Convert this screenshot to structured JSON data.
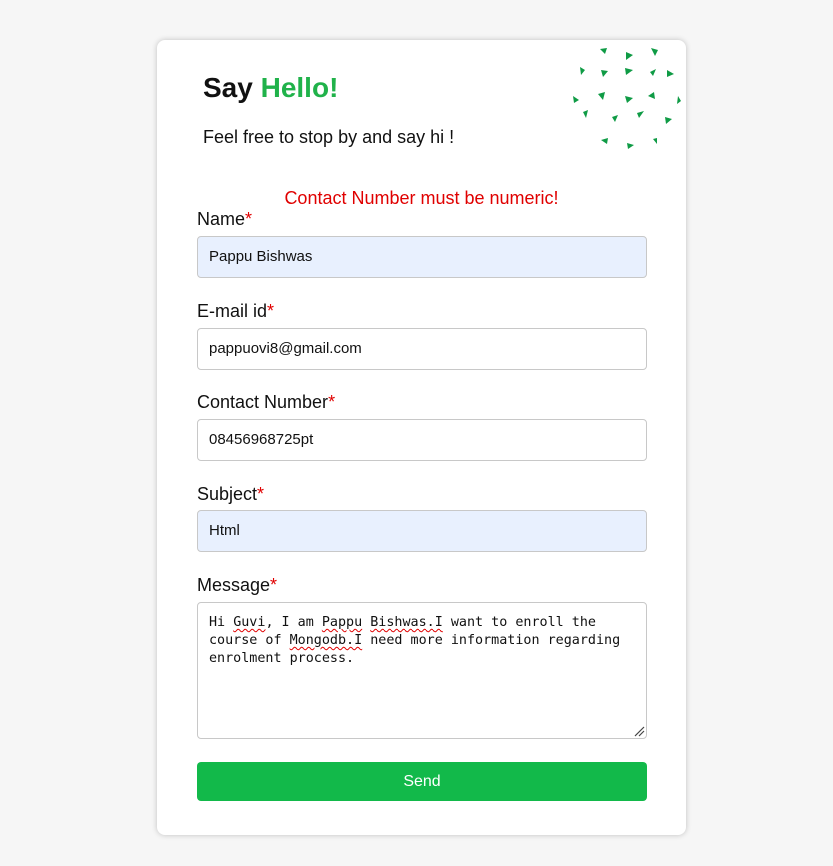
{
  "header": {
    "title_prefix": "Say",
    "title_accent": "Hello!",
    "subtitle": "Feel free to stop by and say hi !"
  },
  "form": {
    "error": "Contact Number must be numeric!",
    "required_marker": "*",
    "fields": {
      "name": {
        "label": "Name",
        "value": "Pappu Bishwas"
      },
      "email": {
        "label": "E-mail id",
        "value": "pappuovi8@gmail.com"
      },
      "contact": {
        "label": "Contact Number",
        "value": "08456968725pt"
      },
      "subject": {
        "label": "Subject",
        "value": "Html"
      },
      "message": {
        "label": "Message",
        "parts": [
          "Hi ",
          "Guvi",
          ", I am ",
          "Pappu",
          " ",
          "Bishwas.I",
          " want to enroll the course of ",
          "Mongodb.I",
          " need more information regarding enrolment process."
        ]
      }
    },
    "send_label": "Send"
  },
  "colors": {
    "accent": "#20b24a",
    "error": "#e00000",
    "button": "#12b94a",
    "autofill_bg": "#e8f0fe",
    "decoration": "#0f9b45"
  },
  "decoration_icon": "triangle-confetti"
}
